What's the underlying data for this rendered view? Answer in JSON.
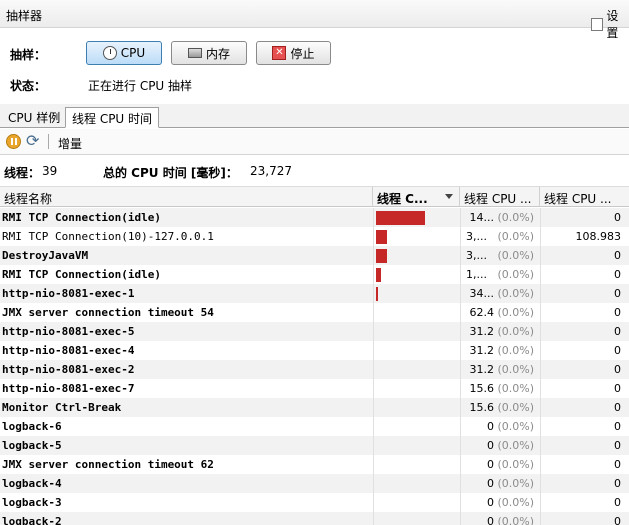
{
  "window": {
    "title": "抽样器",
    "settings_label": "设置"
  },
  "sampler": {
    "label": "抽样：",
    "cpu_button": "CPU",
    "memory_button": "内存",
    "stop_button": "停止"
  },
  "status": {
    "label": "状态：",
    "value": "正在进行 CPU 抽样"
  },
  "tabs": [
    {
      "label": "CPU 样例"
    },
    {
      "label": "线程 CPU 时间"
    }
  ],
  "toolbar": {
    "delta_label": "增量"
  },
  "summary": {
    "threads_label": "线程：",
    "threads_value": "39",
    "total_label": "总的 CPU 时间 [毫秒]：",
    "total_value": "23,727"
  },
  "table": {
    "columns": [
      "线程名称",
      "线程 C...",
      "线程 CPU ...",
      "线程 CPU ..."
    ],
    "rows": [
      {
        "name": "RMI TCP Connection(idle)",
        "bold": true,
        "bar_fraction": 0.6,
        "time": "14...",
        "pct": "(0.0%)",
        "user": "0"
      },
      {
        "name": "RMI TCP Connection(10)-127.0.0.1",
        "bold": false,
        "bar_fraction": 0.14,
        "time": "3,...",
        "pct": "(0.0%)",
        "user": "108.983"
      },
      {
        "name": "DestroyJavaVM",
        "bold": true,
        "bar_fraction": 0.13,
        "time": "3,...",
        "pct": "(0.0%)",
        "user": "0"
      },
      {
        "name": "RMI TCP Connection(idle)",
        "bold": true,
        "bar_fraction": 0.06,
        "time": "1,...",
        "pct": "(0.0%)",
        "user": "0"
      },
      {
        "name": "http-nio-8081-exec-1",
        "bold": true,
        "bar_fraction": 0.01,
        "time": "34...",
        "pct": "(0.0%)",
        "user": "0"
      },
      {
        "name": "JMX server connection timeout 54",
        "bold": true,
        "bar_fraction": 0,
        "time": "62.4",
        "pct": "(0.0%)",
        "user": "0"
      },
      {
        "name": "http-nio-8081-exec-5",
        "bold": true,
        "bar_fraction": 0,
        "time": "31.2",
        "pct": "(0.0%)",
        "user": "0"
      },
      {
        "name": "http-nio-8081-exec-4",
        "bold": true,
        "bar_fraction": 0,
        "time": "31.2",
        "pct": "(0.0%)",
        "user": "0"
      },
      {
        "name": "http-nio-8081-exec-2",
        "bold": true,
        "bar_fraction": 0,
        "time": "31.2",
        "pct": "(0.0%)",
        "user": "0"
      },
      {
        "name": "http-nio-8081-exec-7",
        "bold": true,
        "bar_fraction": 0,
        "time": "15.6",
        "pct": "(0.0%)",
        "user": "0"
      },
      {
        "name": "Monitor Ctrl-Break",
        "bold": true,
        "bar_fraction": 0,
        "time": "15.6",
        "pct": "(0.0%)",
        "user": "0"
      },
      {
        "name": "logback-6",
        "bold": true,
        "bar_fraction": 0,
        "time": "0",
        "pct": "(0.0%)",
        "user": "0"
      },
      {
        "name": "logback-5",
        "bold": true,
        "bar_fraction": 0,
        "time": "0",
        "pct": "(0.0%)",
        "user": "0"
      },
      {
        "name": "JMX server connection timeout 62",
        "bold": true,
        "bar_fraction": 0,
        "time": "0",
        "pct": "(0.0%)",
        "user": "0"
      },
      {
        "name": "logback-4",
        "bold": true,
        "bar_fraction": 0,
        "time": "0",
        "pct": "(0.0%)",
        "user": "0"
      },
      {
        "name": "logback-3",
        "bold": true,
        "bar_fraction": 0,
        "time": "0",
        "pct": "(0.0%)",
        "user": "0"
      },
      {
        "name": "logback-2",
        "bold": true,
        "bar_fraction": 0,
        "time": "0",
        "pct": "(0.0%)",
        "user": "0"
      }
    ]
  }
}
